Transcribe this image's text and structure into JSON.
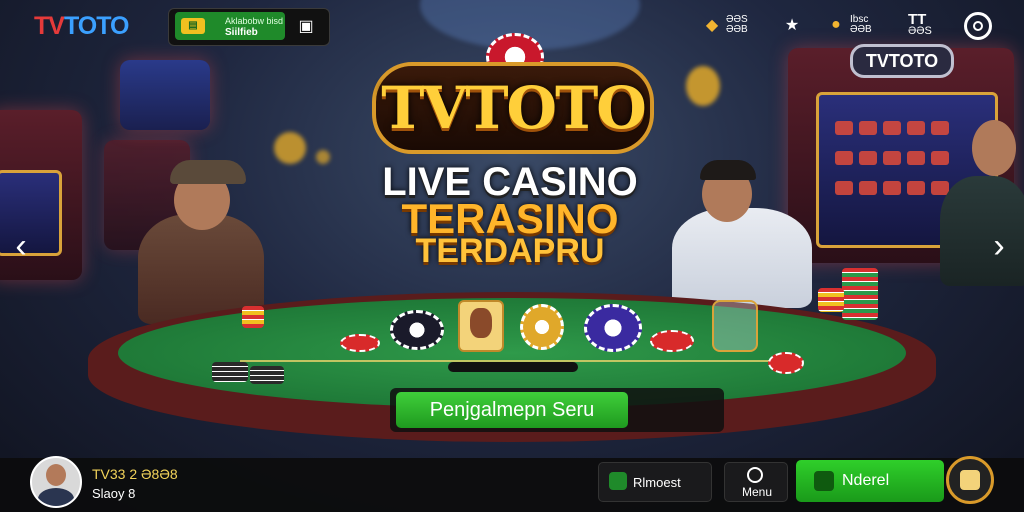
{
  "topbar": {
    "logo_part1": "TV",
    "logo_part2": "TOTO",
    "deposit_line1": "Aklabobw bisd",
    "deposit_line2": "Siilfieb",
    "icons": [
      {
        "name": "coin-icon",
        "label_top": "ƏƏS",
        "label_bottom": "ƏƏB"
      },
      {
        "name": "star-icon",
        "label_top": "",
        "label_bottom": ""
      },
      {
        "name": "gift-icon",
        "label_top": "Ibsc",
        "label_bottom": "ƏƏB"
      },
      {
        "name": "t-icon",
        "label_top": "TT",
        "label_bottom": "ƏƏS"
      }
    ]
  },
  "hero": {
    "logo_text": "TVTOTO",
    "line1": "LIVE CASINO",
    "line2": "TERASINO",
    "line3": "TERDAPRU"
  },
  "table": {
    "machine_sign": "TVTOTO"
  },
  "cta": {
    "label": "Penjgalmepn Seru"
  },
  "bottombar": {
    "user_name": "TV33 2 Ə8Ə8",
    "user_level": "Slaoy 8",
    "rewards_label": "Rlmoest",
    "menu_label": "Menu",
    "primary_label": "Nderel"
  },
  "colors": {
    "accent_green": "#2fcf2a",
    "gold": "#f2b431",
    "logo_red": "#e53a3a",
    "logo_blue": "#3ba0ff"
  }
}
